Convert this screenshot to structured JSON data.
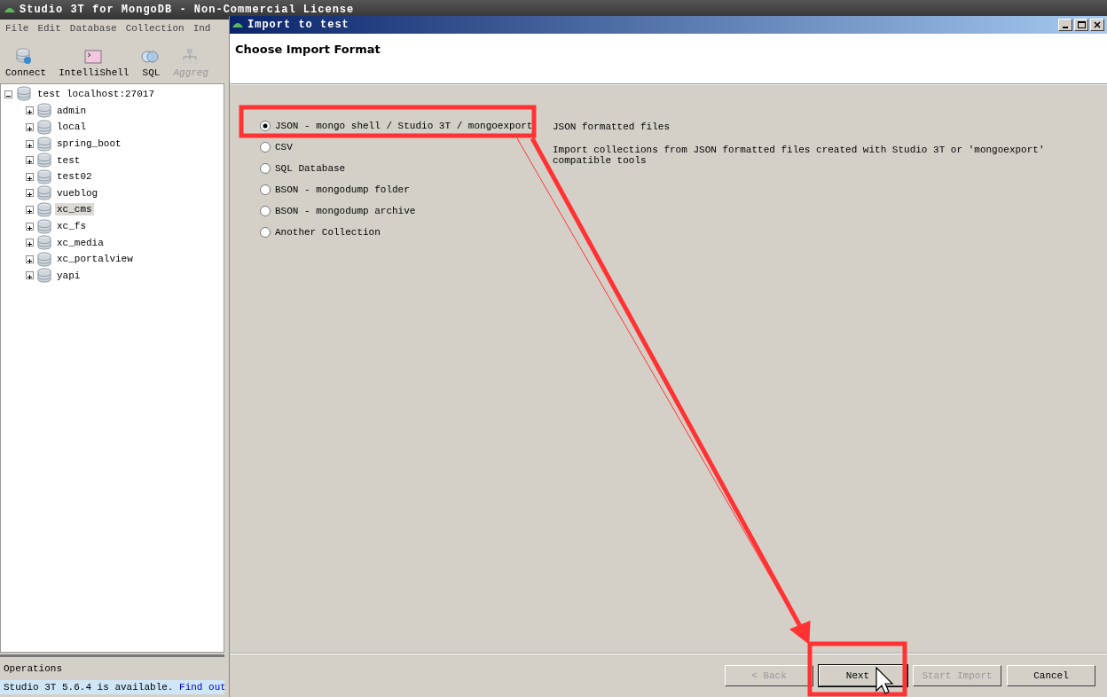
{
  "main_window": {
    "title": "Studio 3T for MongoDB - Non-Commercial License",
    "menu": [
      "File",
      "Edit",
      "Database",
      "Collection",
      "Ind"
    ],
    "toolbar": [
      {
        "label": "Connect",
        "kind": "connect",
        "disabled": false
      },
      {
        "label": "IntelliShell",
        "kind": "shell",
        "disabled": false
      },
      {
        "label": "SQL",
        "kind": "sql",
        "disabled": false
      },
      {
        "label": "Aggreg",
        "kind": "aggregate",
        "disabled": true
      }
    ],
    "tree": {
      "label": "test localhost:27017",
      "expanded": true,
      "children": [
        {
          "label": "admin",
          "selected": false
        },
        {
          "label": "local",
          "selected": false
        },
        {
          "label": "spring_boot",
          "selected": false
        },
        {
          "label": "test",
          "selected": false
        },
        {
          "label": "test02",
          "selected": false
        },
        {
          "label": "vueblog",
          "selected": false
        },
        {
          "label": "xc_cms",
          "selected": true
        },
        {
          "label": "xc_fs",
          "selected": false
        },
        {
          "label": "xc_media",
          "selected": false
        },
        {
          "label": "xc_portalview",
          "selected": false
        },
        {
          "label": "yapi",
          "selected": false
        }
      ]
    },
    "operations_title": "Operations",
    "status": {
      "text": "Studio 3T 5.6.4 is available.",
      "link": "Find out"
    }
  },
  "dialog": {
    "title": "Import to test",
    "heading": "Choose Import Format",
    "formats": [
      {
        "label": "JSON - mongo shell / Studio 3T / mongoexport",
        "selected": true
      },
      {
        "label": "CSV",
        "selected": false
      },
      {
        "label": "SQL Database",
        "selected": false
      },
      {
        "label": "BSON - mongodump folder",
        "selected": false
      },
      {
        "label": "BSON - mongodump archive",
        "selected": false
      },
      {
        "label": "Another Collection",
        "selected": false
      }
    ],
    "description_title": "JSON formatted files",
    "description": "Import collections from JSON formatted files created with Studio 3T or 'mongoexport' compatible tools",
    "buttons": [
      {
        "label": "< Back",
        "disabled": true,
        "focused": false
      },
      {
        "label": "Next",
        "disabled": false,
        "focused": true
      },
      {
        "label": "Start Import",
        "disabled": true,
        "focused": false
      },
      {
        "label": "Cancel",
        "disabled": false,
        "focused": false
      }
    ]
  }
}
